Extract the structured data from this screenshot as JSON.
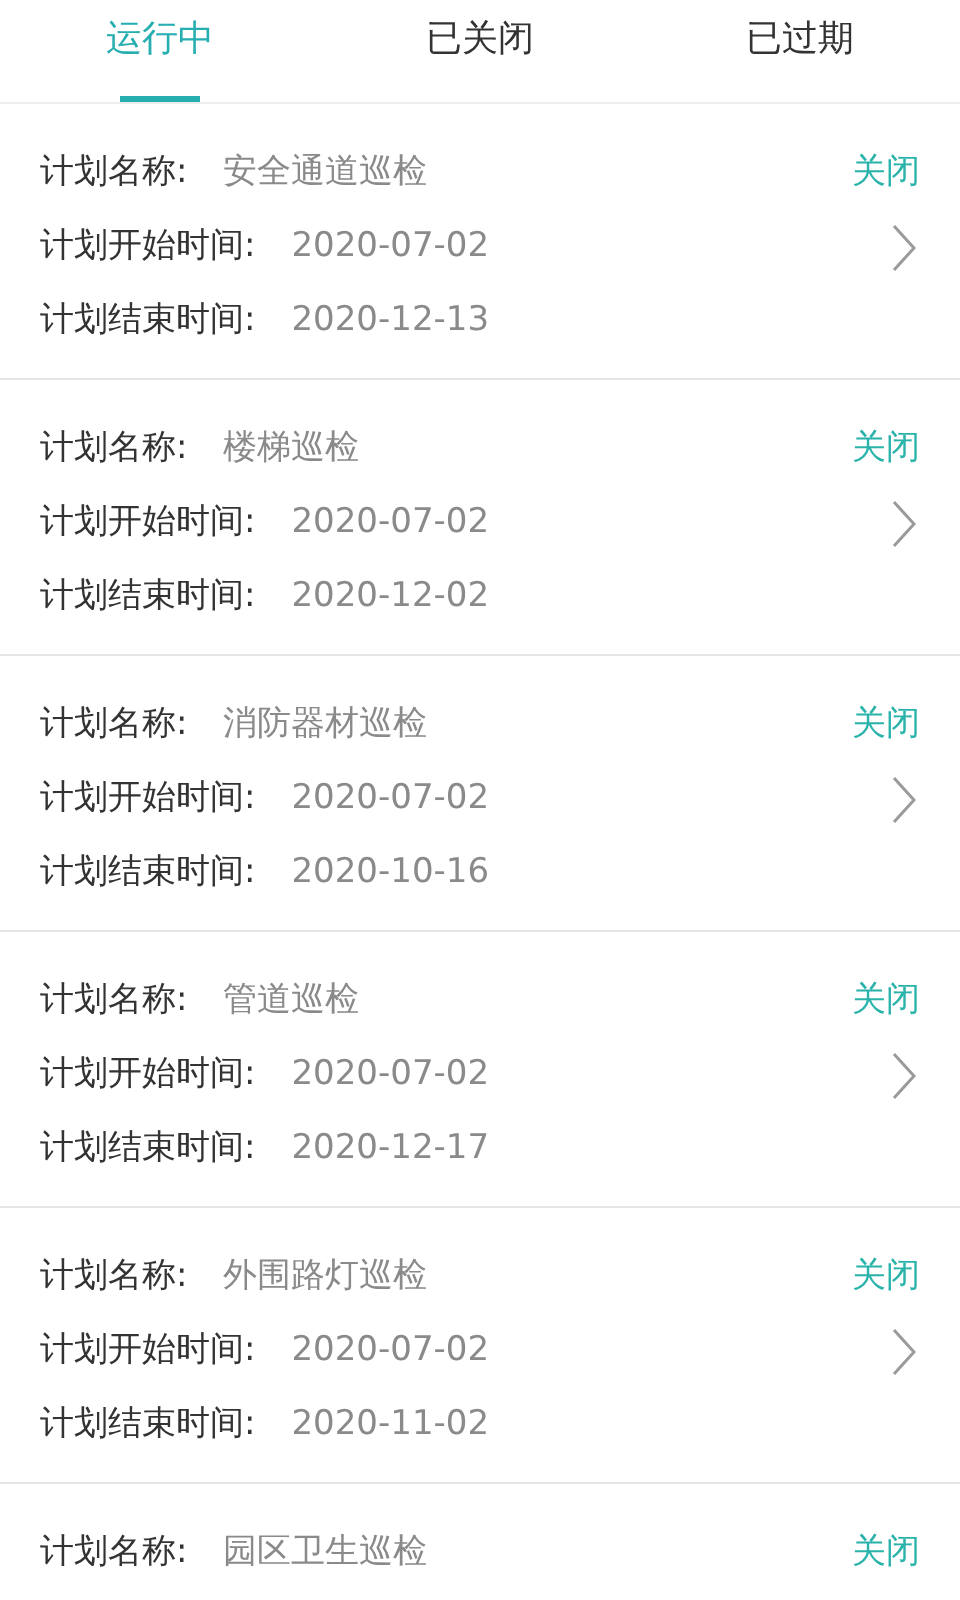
{
  "tabs": [
    {
      "label": "运行中",
      "selected": true
    },
    {
      "label": "已关闭",
      "selected": false
    },
    {
      "label": "已过期",
      "selected": false
    }
  ],
  "plans": [
    {
      "name_label": "计划名称:",
      "name": "安全通道巡检",
      "action": "关闭",
      "start_label": "计划开始时间:",
      "start": "2020-07-02",
      "end_label": "计划结束时间:",
      "end": "2020-12-13"
    },
    {
      "name_label": "计划名称:",
      "name": "楼梯巡检",
      "action": "关闭",
      "start_label": "计划开始时间:",
      "start": "2020-07-02",
      "end_label": "计划结束时间:",
      "end": "2020-12-02"
    },
    {
      "name_label": "计划名称:",
      "name": "消防器材巡检",
      "action": "关闭",
      "start_label": "计划开始时间:",
      "start": "2020-07-02",
      "end_label": "计划结束时间:",
      "end": "2020-10-16"
    },
    {
      "name_label": "计划名称:",
      "name": "管道巡检",
      "action": "关闭",
      "start_label": "计划开始时间:",
      "start": "2020-07-02",
      "end_label": "计划结束时间:",
      "end": "2020-12-17"
    },
    {
      "name_label": "计划名称:",
      "name": "外围路灯巡检",
      "action": "关闭",
      "start_label": "计划开始时间:",
      "start": "2020-07-02",
      "end_label": "计划结束时间:",
      "end": "2020-11-02"
    },
    {
      "name_label": "计划名称:",
      "name": "园区卫生巡检",
      "action": "关闭"
    }
  ]
}
